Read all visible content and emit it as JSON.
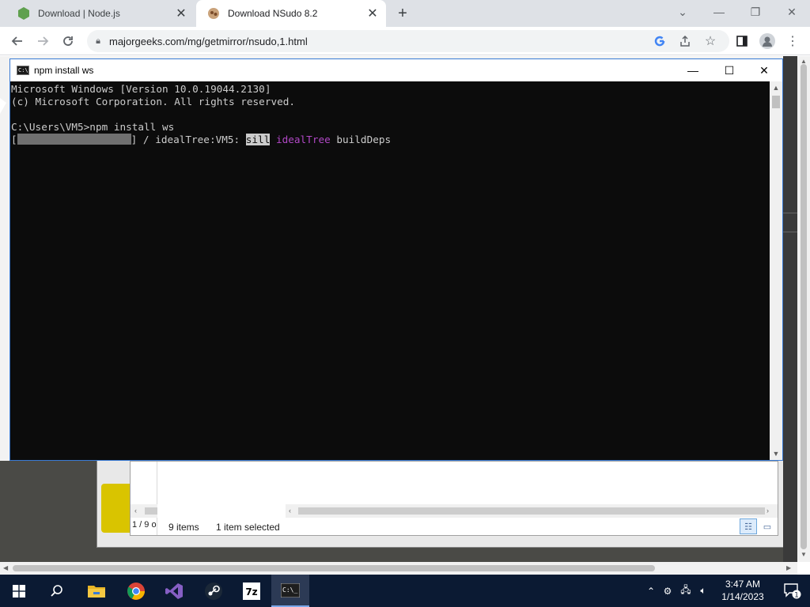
{
  "browser": {
    "tabs": [
      {
        "title": "Download | Node.js",
        "active": false,
        "favicon": "nodejs-hexagon-icon"
      },
      {
        "title": "Download NSudo 8.2",
        "active": true,
        "favicon": "majorgeeks-icon"
      }
    ],
    "url": "majorgeeks.com/mg/getmirror/nsudo,1.html"
  },
  "console": {
    "title": "npm install ws",
    "lines": {
      "l1": "Microsoft Windows [Version 10.0.19044.2130]",
      "l2": "(c) Microsoft Corporation. All rights reserved.",
      "l3": "C:\\Users\\VM5>npm install ws",
      "l4_open": "[",
      "l4_mid": "] / idealTree:VM5: ",
      "l4_sill": "sill",
      "l4_tree": "idealTree",
      "l4_end": "buildDeps"
    }
  },
  "explorer": {
    "pager": "1 / 9 o",
    "item_count": "9 items",
    "selection": "1 item selected"
  },
  "taskbar": {
    "time": "3:47 AM",
    "date": "1/14/2023",
    "notification_count": "1"
  },
  "colors": {
    "console_bg": "#0c0c0c",
    "console_text": "#cccccc",
    "magenta": "#b148c6",
    "taskbar": "#0b1a33"
  }
}
